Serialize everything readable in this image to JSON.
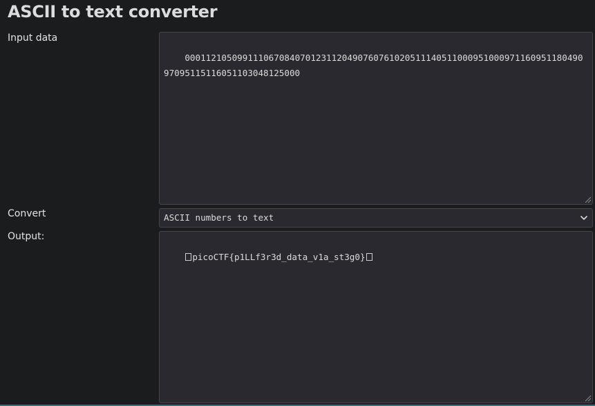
{
  "page": {
    "title": "ASCII to text converter"
  },
  "form": {
    "input_label": "Input data",
    "input_value": "000112105099111067084070123112049076076102051114051100095100097116095118049097095115116051103048125000",
    "convert_label": "Convert",
    "convert_selected": "ASCII numbers to text",
    "output_label": "Output:",
    "output_prefix_control": "␀",
    "output_value": "picoCTF{p1LLf3r3d_data_v1a_st3g0}",
    "output_suffix_control": "␀"
  },
  "icons": {
    "select_chevron": "chevron-down-icon",
    "resize_grip": "resize-grip-icon",
    "null_char": "null-char-icon"
  },
  "colors": {
    "background": "#1b1c1e",
    "field_background": "#2a2930",
    "field_border": "#45454c",
    "text": "#dcdcdc",
    "accent_line": "#3b6f7a"
  }
}
